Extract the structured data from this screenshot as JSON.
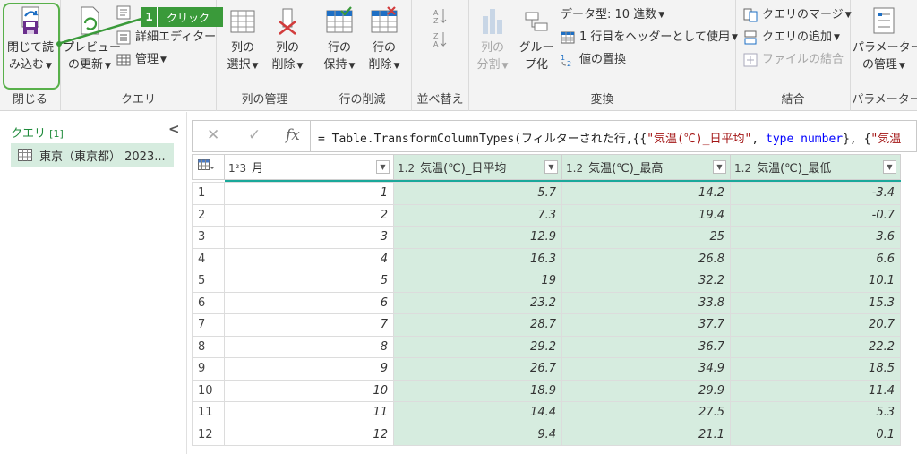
{
  "ribbon": {
    "close": {
      "label1": "閉じて読",
      "label2": "み込む",
      "group": "閉じる"
    },
    "query": {
      "preview_label1": "プレビュー",
      "preview_label2": "の更新",
      "advanced_editor": "詳細エディター",
      "manage": "管理",
      "group": "クエリ"
    },
    "callout": {
      "number": "1",
      "text": "クリック"
    },
    "columns": {
      "choose_1": "列の",
      "choose_2": "選択",
      "remove_1": "列の",
      "remove_2": "削除",
      "group": "列の管理"
    },
    "rows": {
      "keep_1": "行の",
      "keep_2": "保持",
      "remove_1": "行の",
      "remove_2": "削除",
      "group": "行の削減"
    },
    "sort": {
      "group": "並べ替え"
    },
    "transform": {
      "split_1": "列の",
      "split_2": "分割",
      "group_by_1": "グルー",
      "group_by_2": "プ化",
      "data_type": "データ型: 10 進数",
      "first_row_header": "1 行目をヘッダーとして使用",
      "replace_values": "値の置換",
      "group": "変換"
    },
    "combine": {
      "merge": "クエリのマージ",
      "append": "クエリの追加",
      "combine_files": "ファイルの結合",
      "group": "結合"
    },
    "params": {
      "label1": "パラメーター",
      "label2": "の管理",
      "group": "パラメーター"
    }
  },
  "left_panel": {
    "title": "クエリ",
    "count": "[1]",
    "collapse": "<",
    "query_item": "東京（東京都） 2023..."
  },
  "formula_bar": {
    "cancel": "✕",
    "confirm": "✓",
    "fx": "fx",
    "prefix": "= Table.TransformColumnTypes(フィルターされた行,{{",
    "str1": "\"気温(℃)_日平均\"",
    "mid": ", ",
    "kw": "type number",
    "suffix": "}, {",
    "str2": "\"気温"
  },
  "table": {
    "columns": [
      {
        "type": "1²3",
        "name": "月"
      },
      {
        "type": "1.2",
        "name": "気温(℃)_日平均"
      },
      {
        "type": "1.2",
        "name": "気温(℃)_最高"
      },
      {
        "type": "1.2",
        "name": "気温(℃)_最低"
      }
    ],
    "rows": [
      [
        "1",
        "1",
        "5.7",
        "14.2",
        "-3.4"
      ],
      [
        "2",
        "2",
        "7.3",
        "19.4",
        "-0.7"
      ],
      [
        "3",
        "3",
        "12.9",
        "25",
        "3.6"
      ],
      [
        "4",
        "4",
        "16.3",
        "26.8",
        "6.6"
      ],
      [
        "5",
        "5",
        "19",
        "32.2",
        "10.1"
      ],
      [
        "6",
        "6",
        "23.2",
        "33.8",
        "15.3"
      ],
      [
        "7",
        "7",
        "28.7",
        "37.7",
        "20.7"
      ],
      [
        "8",
        "8",
        "29.2",
        "36.7",
        "22.2"
      ],
      [
        "9",
        "9",
        "26.7",
        "34.9",
        "18.5"
      ],
      [
        "10",
        "10",
        "18.9",
        "29.9",
        "11.4"
      ],
      [
        "11",
        "11",
        "14.4",
        "27.5",
        "5.3"
      ],
      [
        "12",
        "12",
        "9.4",
        "21.1",
        "0.1"
      ]
    ]
  },
  "colors": {
    "accent_green": "#3a9a3a",
    "selected_col": "#d6ecdf",
    "teal_bar": "#1aa89a"
  }
}
